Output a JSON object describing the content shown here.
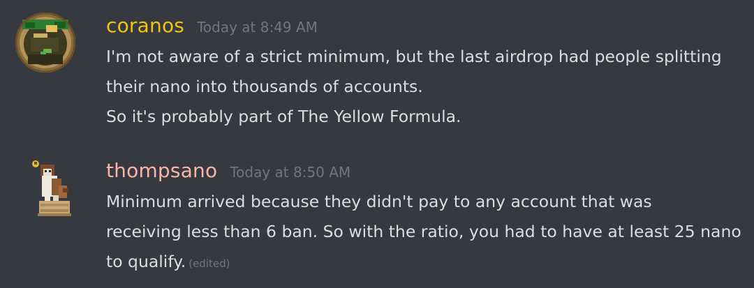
{
  "messages": [
    {
      "author": "coranos",
      "author_color": "#f1c40f",
      "timestamp": "Today at 8:49 AM",
      "avatar_icon": "pixel-art-face-avatar",
      "lines": [
        "I'm not aware of a strict minimum, but the last airdrop had people splitting",
        "their nano into thousands of accounts.",
        "So it's probably part of The Yellow Formula."
      ]
    },
    {
      "author": "thompsano",
      "author_color": "#f8b5a8",
      "timestamp": "Today at 8:50 AM",
      "avatar_icon": "pixel-art-dog-avatar",
      "lines": [
        "Minimum arrived because they didn't pay to any account that was",
        "receiving less than 6 ban.  So with the ratio, you had to have at least 25 nano",
        "to qualify."
      ],
      "edited_label": "(edited)"
    }
  ]
}
